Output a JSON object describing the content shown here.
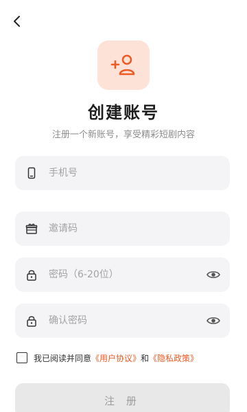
{
  "header": {
    "back_icon": "chevron-left-icon"
  },
  "logo": {
    "icon": "add-user-icon",
    "accent_color": "#ef5a24",
    "background_color": "#fde3d7"
  },
  "title": "创建账号",
  "subtitle": "注册一个新账号，享受精彩短剧内容",
  "fields": {
    "phone": {
      "icon": "phone-icon",
      "placeholder": "手机号"
    },
    "invite": {
      "icon": "gift-icon",
      "placeholder": "邀请码"
    },
    "password": {
      "icon": "lock-icon",
      "placeholder": "密码（6-20位）",
      "toggle_icon": "eye-icon"
    },
    "confirm": {
      "icon": "lock-icon",
      "placeholder": "确认密码",
      "toggle_icon": "eye-icon"
    }
  },
  "agreement": {
    "prefix": "我已阅读并同意",
    "user_agreement": "《用户协议》",
    "and": "和",
    "privacy_policy": "《隐私政策》",
    "checked": false
  },
  "submit_label": "注 册"
}
